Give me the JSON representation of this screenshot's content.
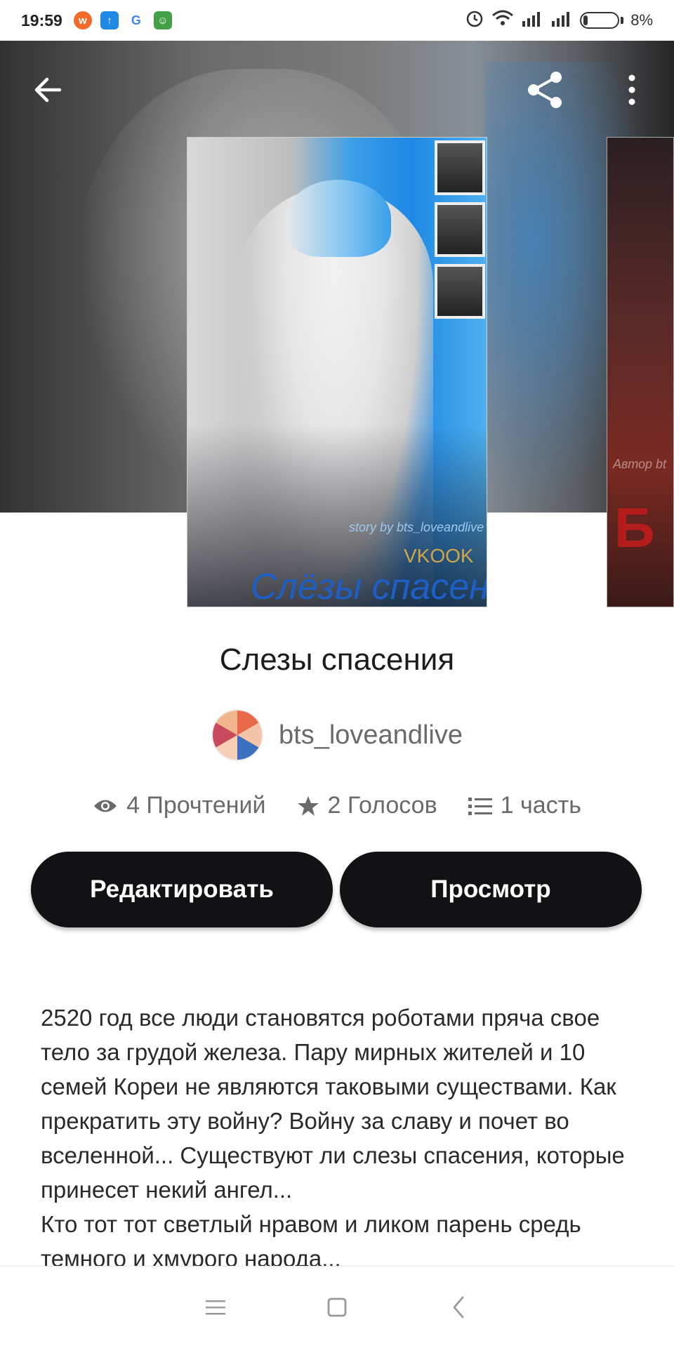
{
  "status_bar": {
    "time": "19:59",
    "battery_text": "8%",
    "notification_icons": [
      "weibo-icon",
      "upload-icon",
      "google-icon",
      "android-icon"
    ],
    "system_icons": [
      "alarm-icon",
      "wifi-icon",
      "signal-icon",
      "signal-icon",
      "battery-icon"
    ]
  },
  "header": {
    "back_icon": "arrow-left-icon",
    "share_icon": "share-icon",
    "more_icon": "more-vertical-icon"
  },
  "cover": {
    "story_by": "story by bts_loveandlive",
    "tag": "VKOOK",
    "title": "Слёзы спасения"
  },
  "next_cover": {
    "author_text": "Автор bt",
    "big_text": "Б"
  },
  "story": {
    "title": "Слезы спасения",
    "author": "bts_loveandlive",
    "reads": "4 Прочтений",
    "votes": "2 Голосов",
    "parts": "1 часть",
    "description": "2520 год все люди становятся роботами пряча свое тело за грудой железа. Пару мирных жителей и 10 семей Кореи не являются таковыми существами. Как прекратить эту войну? Войну за славу и почет во вселенной... Существуют ли слезы спасения, которые принесет некий ангел...\nКто тот тот светлый нравом и ликом парень средь темного и хмурого народа..."
  },
  "actions": {
    "edit_label": "Редактировать",
    "view_label": "Просмотр"
  },
  "nav_bar": {
    "icons": [
      "menu-icon",
      "home-square-icon",
      "back-chevron-icon"
    ]
  },
  "colors": {
    "button_bg": "#121214",
    "button_text": "#ffffff",
    "meta_text": "#6a6a6a",
    "title_text": "#1c1c1c"
  }
}
